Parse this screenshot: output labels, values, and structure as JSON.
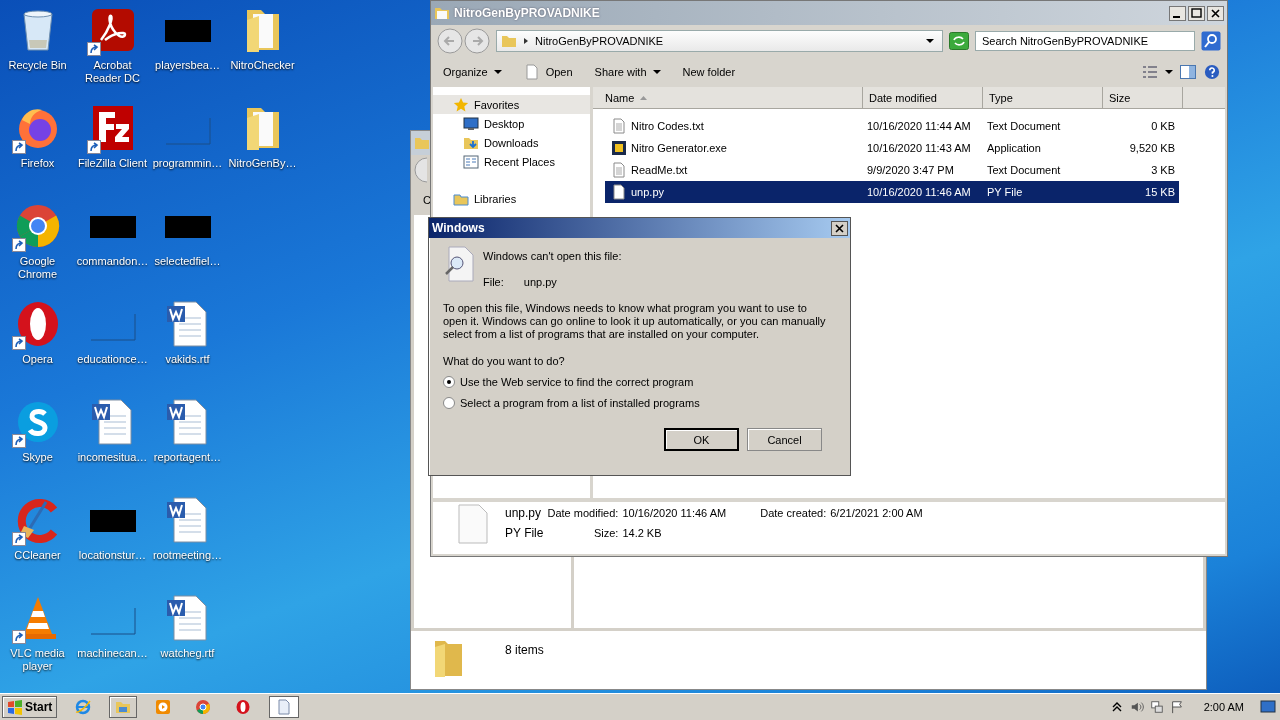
{
  "desktop": {
    "icons": [
      {
        "label": "Recycle Bin",
        "kind": "recycle",
        "shortcut": false
      },
      {
        "label": "Firefox",
        "kind": "firefox",
        "shortcut": true
      },
      {
        "label": "Google Chrome",
        "kind": "chrome",
        "shortcut": true
      },
      {
        "label": "Opera",
        "kind": "opera",
        "shortcut": true
      },
      {
        "label": "Skype",
        "kind": "skype",
        "shortcut": true
      },
      {
        "label": "CCleaner",
        "kind": "ccleaner",
        "shortcut": true
      },
      {
        "label": "VLC media player",
        "kind": "vlc",
        "shortcut": true
      },
      {
        "label": "Acrobat Reader DC",
        "kind": "acrobat",
        "shortcut": true
      },
      {
        "label": "FileZilla Client",
        "kind": "filezilla",
        "shortcut": true
      },
      {
        "label": "commandon…",
        "kind": "redacted",
        "shortcut": false
      },
      {
        "label": "educationce…",
        "kind": "blank",
        "shortcut": false
      },
      {
        "label": "incomesitua…",
        "kind": "word",
        "shortcut": false
      },
      {
        "label": "locationstur…",
        "kind": "redacted",
        "shortcut": false
      },
      {
        "label": "machinecan…",
        "kind": "blank",
        "shortcut": false
      },
      {
        "label": "playersbea…",
        "kind": "redacted",
        "shortcut": false
      },
      {
        "label": "programmin…",
        "kind": "blank",
        "shortcut": false
      },
      {
        "label": "selectedfiel…",
        "kind": "redacted",
        "shortcut": false
      },
      {
        "label": "vakids.rtf",
        "kind": "word",
        "shortcut": false
      },
      {
        "label": "reportagent…",
        "kind": "word",
        "shortcut": false
      },
      {
        "label": "rootmeeting…",
        "kind": "word",
        "shortcut": false
      },
      {
        "label": "watcheg.rtf",
        "kind": "word",
        "shortcut": false
      },
      {
        "label": "NitroChecker",
        "kind": "folder",
        "shortcut": false
      },
      {
        "label": "NitroGenBy…",
        "kind": "folder",
        "shortcut": false
      }
    ]
  },
  "back_window": {
    "toolbar_fragment": "C",
    "status": "8 items"
  },
  "explorer": {
    "title": "NitroGenByPROVADNIKE",
    "address": "NitroGenByPROVADNIKE",
    "search": {
      "placeholder": "Search NitroGenByPROVADNIKE"
    },
    "toolbar": [
      {
        "label": "Organize",
        "kind": "menu"
      },
      {
        "label": "Open",
        "kind": "open"
      },
      {
        "label": "Share with",
        "kind": "menu"
      },
      {
        "label": "New folder",
        "kind": "plain"
      }
    ],
    "nav": [
      {
        "label": "Favorites",
        "kind": "star",
        "selected": true,
        "children": [
          {
            "label": "Desktop",
            "kind": "desktop",
            "selected": false
          },
          {
            "label": "Downloads",
            "kind": "downloads",
            "selected": false
          },
          {
            "label": "Recent Places",
            "kind": "recent",
            "selected": false
          }
        ]
      },
      {
        "label": "Libraries",
        "kind": "library",
        "selected": false
      }
    ],
    "columns": [
      "Name",
      "Date modified",
      "Type",
      "Size"
    ],
    "rows": [
      {
        "name": "Nitro Codes.txt",
        "date": "10/16/2020 11:44 AM",
        "type": "Text Document",
        "size": "0 KB",
        "kind": "text",
        "selected": false
      },
      {
        "name": "Nitro Generator.exe",
        "date": "10/16/2020 11:43 AM",
        "type": "Application",
        "size": "9,520 KB",
        "kind": "exe",
        "selected": false
      },
      {
        "name": "ReadMe.txt",
        "date": "9/9/2020 3:47 PM",
        "type": "Text Document",
        "size": "3 KB",
        "kind": "text",
        "selected": false
      },
      {
        "name": "unp.py",
        "date": "10/16/2020 11:46 AM",
        "type": "PY File",
        "size": "15 KB",
        "kind": "blank",
        "selected": true
      }
    ],
    "details": {
      "name": "unp.py",
      "type": "PY File",
      "modified_label": "Date modified:",
      "modified": "10/16/2020 11:46 AM",
      "created_label": "Date created:",
      "created": "6/21/2021 2:00 AM",
      "size_label": "Size:",
      "size": "14.2 KB"
    }
  },
  "dialog": {
    "title": "Windows",
    "heading": "Windows can't open this file:",
    "file_label": "File:",
    "file": "unp.py",
    "message": "To open this file, Windows needs to know what program you want to use to open it. Windows can go online to look it up automatically, or you can manually select from a list of programs that are installed on your computer.",
    "question": "What do you want to do?",
    "options": [
      {
        "label": "Use the Web service to find the correct program",
        "selected": true
      },
      {
        "label": "Select a program from a list of installed programs",
        "selected": false
      }
    ],
    "buttons": [
      {
        "label": "OK",
        "default": true
      },
      {
        "label": "Cancel",
        "default": false
      }
    ]
  },
  "taskbar": {
    "start": "Start",
    "items": [
      {
        "kind": "ie",
        "active": false
      },
      {
        "kind": "explorer",
        "active": true
      },
      {
        "kind": "media",
        "active": false
      },
      {
        "kind": "chrome",
        "active": false
      },
      {
        "kind": "opera",
        "active": false
      },
      {
        "kind": "window",
        "active": true
      }
    ],
    "clock": "2:00 AM"
  }
}
